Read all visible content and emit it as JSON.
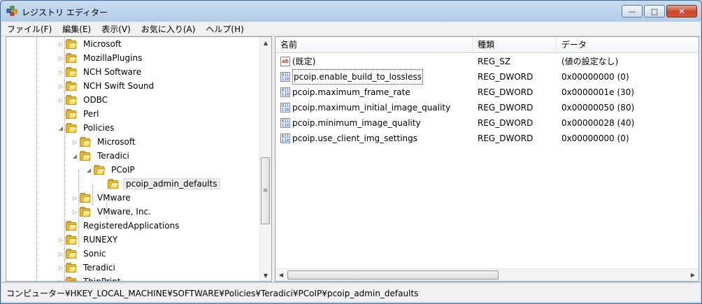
{
  "window": {
    "title": "レジストリ エディター",
    "minimize": "—",
    "maximize": "□",
    "close": "✕"
  },
  "menu": [
    "ファイル(F)",
    "編集(E)",
    "表示(V)",
    "お気に入り(A)",
    "ヘルプ(H)"
  ],
  "tree": [
    {
      "label": "Microsoft",
      "expander": "▷",
      "level": 0
    },
    {
      "label": "MozillaPlugins",
      "expander": "▷",
      "level": 0
    },
    {
      "label": "NCH Software",
      "expander": "▷",
      "level": 0
    },
    {
      "label": "NCH Swift Sound",
      "expander": "▷",
      "level": 0
    },
    {
      "label": "ODBC",
      "expander": "▷",
      "level": 0
    },
    {
      "label": "Perl",
      "expander": "",
      "level": 0
    },
    {
      "label": "Policies",
      "expander": "◢",
      "level": 0
    },
    {
      "label": "Microsoft",
      "expander": "▷",
      "level": 1
    },
    {
      "label": "Teradici",
      "expander": "◢",
      "level": 1
    },
    {
      "label": "PCoIP",
      "expander": "◢",
      "level": 2
    },
    {
      "label": "pcoip_admin_defaults",
      "expander": "",
      "level": 3,
      "selected": true
    },
    {
      "label": "VMware",
      "expander": "▷",
      "level": 1
    },
    {
      "label": "VMware, Inc.",
      "expander": "▷",
      "level": 1
    },
    {
      "label": "RegisteredApplications",
      "expander": "",
      "level": 0
    },
    {
      "label": "RUNEXY",
      "expander": "▷",
      "level": 0
    },
    {
      "label": "Sonic",
      "expander": "▷",
      "level": 0
    },
    {
      "label": "Teradici",
      "expander": "▷",
      "level": 0
    },
    {
      "label": "ThinPrint",
      "expander": "▷",
      "level": 0
    }
  ],
  "columns": [
    "名前",
    "種類",
    "データ"
  ],
  "values": [
    {
      "name": "(既定)",
      "type": "REG_SZ",
      "data": "(値の設定なし)",
      "icon": "string-value-icon",
      "glyph": "ab"
    },
    {
      "name": "pcoip.enable_build_to_lossless",
      "type": "REG_DWORD",
      "data": "0x00000000 (0)",
      "icon": "binary-value-icon",
      "glyph": "011\n110",
      "focused": true
    },
    {
      "name": "pcoip.maximum_frame_rate",
      "type": "REG_DWORD",
      "data": "0x0000001e (30)",
      "icon": "binary-value-icon",
      "glyph": "011\n110"
    },
    {
      "name": "pcoip.maximum_initial_image_quality",
      "type": "REG_DWORD",
      "data": "0x00000050 (80)",
      "icon": "binary-value-icon",
      "glyph": "011\n110"
    },
    {
      "name": "pcoip.minimum_image_quality",
      "type": "REG_DWORD",
      "data": "0x00000028 (40)",
      "icon": "binary-value-icon",
      "glyph": "011\n110"
    },
    {
      "name": "pcoip.use_client_img_settings",
      "type": "REG_DWORD",
      "data": "0x00000000 (0)",
      "icon": "binary-value-icon",
      "glyph": "011\n110"
    }
  ],
  "scroll": {
    "up": "▲",
    "down": "▼",
    "left": "◀",
    "right": "▶",
    "grip": "≡"
  },
  "status": "コンピューター¥HKEY_LOCAL_MACHINE¥SOFTWARE¥Policies¥Teradici¥PCoIP¥pcoip_admin_defaults"
}
